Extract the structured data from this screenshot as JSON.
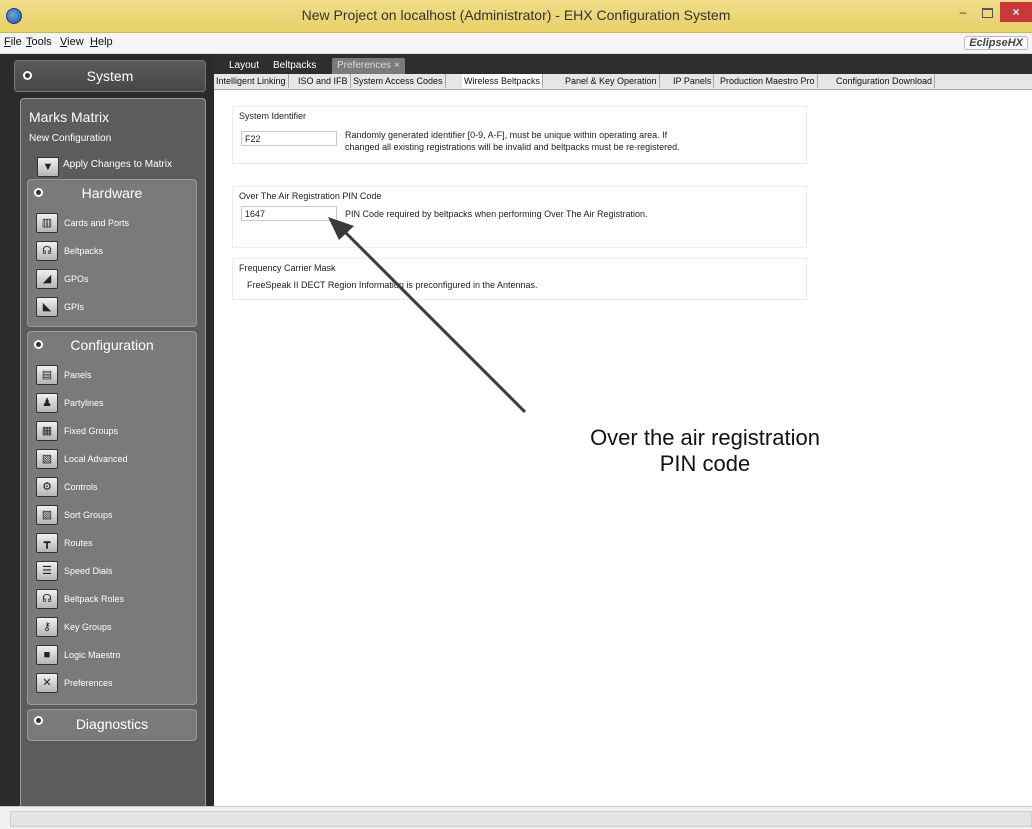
{
  "window": {
    "title": "New Project on localhost (Administrator) - EHX Configuration System",
    "minimize": "–",
    "close": "×"
  },
  "menu": {
    "items": [
      {
        "accel": "F",
        "rest": "ile"
      },
      {
        "accel": "T",
        "rest": "ools"
      },
      {
        "accel": "V",
        "rest": "iew"
      },
      {
        "accel": "H",
        "rest": "elp"
      }
    ],
    "logo": "EclipseHX"
  },
  "sidebar": {
    "system_label": "System",
    "matrix_title": "Marks Matrix",
    "matrix_subtitle": "New Configuration",
    "apply_label": "Apply Changes to Matrix",
    "hardware": {
      "title": "Hardware",
      "items": [
        {
          "label": "Cards and Ports",
          "icon": "cards-ports-icon"
        },
        {
          "label": "Beltpacks",
          "icon": "beltpacks-icon"
        },
        {
          "label": "GPOs",
          "icon": "gpos-icon"
        },
        {
          "label": "GPIs",
          "icon": "gpis-icon"
        }
      ]
    },
    "configuration": {
      "title": "Configuration",
      "items": [
        {
          "label": "Panels",
          "icon": "panels-icon"
        },
        {
          "label": "Partylines",
          "icon": "partylines-icon"
        },
        {
          "label": "Fixed Groups",
          "icon": "fixed-groups-icon"
        },
        {
          "label": "Local Advanced",
          "icon": "local-advanced-icon"
        },
        {
          "label": "Controls",
          "icon": "controls-icon"
        },
        {
          "label": "Sort Groups",
          "icon": "sort-groups-icon"
        },
        {
          "label": "Routes",
          "icon": "routes-icon"
        },
        {
          "label": "Speed Dials",
          "icon": "speed-dials-icon"
        },
        {
          "label": "Beltpack Roles",
          "icon": "beltpack-roles-icon"
        },
        {
          "label": "Key Groups",
          "icon": "key-groups-icon"
        },
        {
          "label": "Logic Maestro",
          "icon": "logic-maestro-icon"
        },
        {
          "label": "Preferences",
          "icon": "preferences-icon"
        }
      ]
    },
    "diagnostics": {
      "title": "Diagnostics"
    }
  },
  "tabs": {
    "top": [
      {
        "label": "Layout"
      },
      {
        "label": "Beltpacks"
      },
      {
        "label": "Preferences",
        "active": true,
        "close": "×"
      }
    ],
    "sub": [
      {
        "label": "Intelligent Linking"
      },
      {
        "label": "ISO and IFB"
      },
      {
        "label": "System Access Codes"
      },
      {
        "label": "Wireless Beltpacks",
        "active": true
      },
      {
        "label": "Panel & Key Operation"
      },
      {
        "label": "IP Panels"
      },
      {
        "label": "Production Maestro Pro"
      },
      {
        "label": "Configuration Download"
      }
    ]
  },
  "content": {
    "system_identifier": {
      "title": "System Identifier",
      "value": "F22",
      "desc_line1": "Randomly generated identifier [0-9, A-F], must be unique within operating area.  If",
      "desc_line2": "changed all existing registrations will be invalid and beltpacks must be re-registered."
    },
    "ota_pin": {
      "title": "Over The Air Registration PIN Code",
      "value": "1647",
      "desc": "PIN Code required by beltpacks when performing Over The Air Registration."
    },
    "freq_mask": {
      "title": "Frequency Carrier Mask",
      "desc": "FreeSpeak II DECT Region Information is preconfigured in the Antennas."
    }
  },
  "annotation": {
    "line1": "Over the air registration",
    "line2": "PIN code"
  },
  "colors": {
    "titlebar": "#e8cf67",
    "close_button": "#c7393a",
    "sidebar_bg": "#2b2b2b",
    "arrow": "#3a3a3a"
  }
}
